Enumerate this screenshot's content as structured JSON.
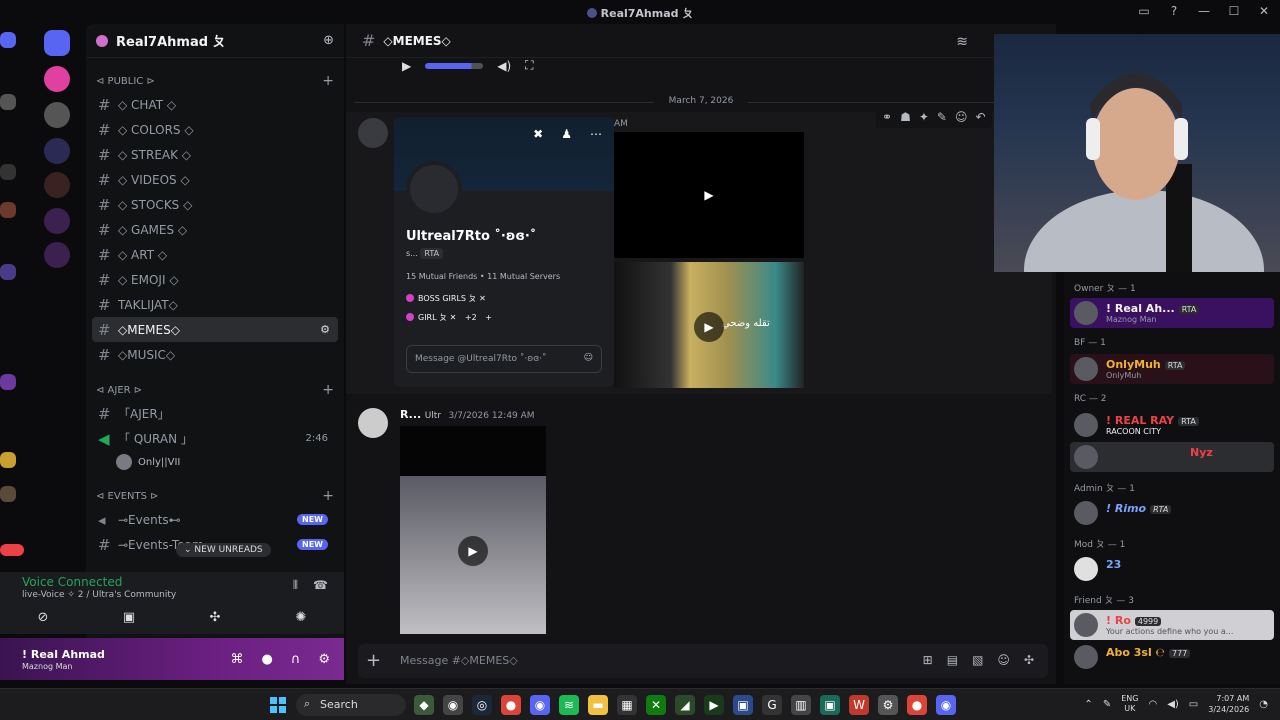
{
  "window": {
    "title": "Real7Ahmad ㄆ"
  },
  "server": {
    "name": "Real7Ahmad ㄆ"
  },
  "categories": {
    "public": "⊲ PUBLIC ⊳",
    "ajer": "⊲ AJER ⊳",
    "events": "⊲ EVENTS ⊳"
  },
  "channels": [
    "◇ CHAT ◇",
    "◇ COLORS ◇",
    "◇ STREAK ◇",
    "◇ VIDEOS ◇",
    "◇ STOCKS ◇",
    "◇ GAMES ◇",
    "◇ ART ◇",
    "◇ EMOJI ◇",
    "TAKLIJAT◇",
    "◇MEMES◇",
    "◇MUSIC◇"
  ],
  "ajer_channels": {
    "ajer": "「AJER」",
    "quran": "「 QURAN 」",
    "quran_time": "2:46",
    "voice_user": "Only||VII"
  },
  "event_channels": [
    {
      "label": "⊸Events⊷",
      "badge": "NEW"
    },
    {
      "label": "⊸Events-Team",
      "badge": "NEW"
    }
  ],
  "new_unreads": "NEW UNREADS",
  "voice": {
    "status": "Voice Connected",
    "channel": "live-Voice ✧ 2 / Ultra's Community"
  },
  "user": {
    "name": "! Real Ahmad",
    "status": "Maznog Man"
  },
  "chat": {
    "channel": "◇MEMES◇",
    "date": "March 7, 2026",
    "message_time_partial": "AM",
    "msg2_author": "R...",
    "msg2_tag": "Ultr",
    "msg2_time": "3/7/2026 12:49 AM",
    "composer_placeholder": "Message #◇MEMES◇"
  },
  "popout": {
    "username": "Ultreal7Rto ˚·ʚɞ·˚",
    "short_name": "s...",
    "tag": "RTA",
    "mutual": "15 Mutual Friends • 11 Mutual Servers",
    "role1": "BOSS GIRLS ㄆ",
    "role2": "GIRL ㄆ",
    "more_roles": "+2",
    "message_placeholder": "Message @Ultreal7Rto ˚·ʚɞ·˚"
  },
  "video_overlay_text": "تقله وضحي",
  "members": [
    {
      "group": "Owner ㄆ — 1",
      "items": [
        {
          "name": "! Real Ah...",
          "tag": "RTA",
          "status": "Maznog Man",
          "color": "#f2f3f5"
        }
      ]
    },
    {
      "group": "BF — 1",
      "items": [
        {
          "name": "OnlyMuh",
          "tag": "RTA",
          "status": "OnlyMuh",
          "color": "#f0b232"
        }
      ]
    },
    {
      "group": "RC — 2",
      "items": [
        {
          "name": "! REAL RAY",
          "tag": "RTA",
          "status": "RACOON CITY",
          "color": "#ed4245"
        },
        {
          "name": "Nyz",
          "tag": "",
          "status": "",
          "color": "#ed4245"
        }
      ]
    },
    {
      "group": "Admin ㄆ — 1",
      "items": [
        {
          "name": "! Rimo",
          "tag": "RTA",
          "status": "",
          "color": "#7aa2ff"
        }
      ]
    },
    {
      "group": "Mod ㄆ — 1",
      "items": [
        {
          "name": "23",
          "tag": "",
          "status": "",
          "color": "#7aa2ff"
        }
      ]
    },
    {
      "group": "Friend ㄆ — 3",
      "items": [
        {
          "name": "! Ro",
          "tag": "4999",
          "status": "Your actions define who you a...",
          "color": "#f2f3f5"
        },
        {
          "name": "Abo 3sl ℮",
          "tag": "777",
          "status": "",
          "color": "#f0b232"
        }
      ]
    }
  ],
  "taskbar": {
    "search": "Search",
    "lang": "ENG",
    "region": "UK",
    "time": "7:07 AM",
    "date": "3/24/2026"
  },
  "colors": {
    "accent": "#5865f2",
    "voice_green": "#23a55a",
    "userbar": "#6a1f80"
  }
}
